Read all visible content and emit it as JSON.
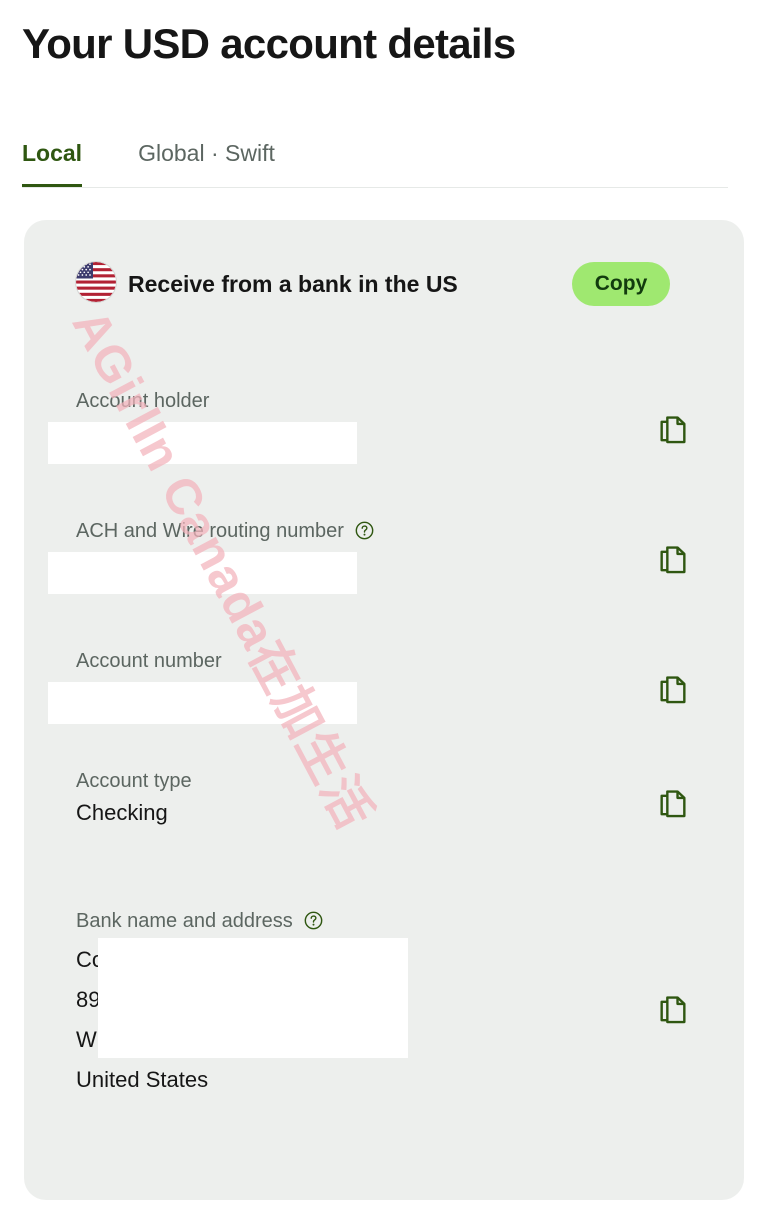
{
  "page": {
    "title": "Your USD account details"
  },
  "tabs": [
    {
      "label": "Local",
      "active": true
    },
    {
      "label": "Global · Swift",
      "active": false
    }
  ],
  "card": {
    "flag_icon": "us-flag-icon",
    "header_title": "Receive from a bank in the US",
    "copy_all_label": "Copy",
    "copy_icon": "copy-icon",
    "help_icon": "help-circle-icon",
    "fields": [
      {
        "label": "Account holder",
        "has_help": false,
        "value": "",
        "redacted": true
      },
      {
        "label": "ACH and Wire routing number",
        "has_help": true,
        "value": "",
        "redacted": true
      },
      {
        "label": "Account number",
        "has_help": false,
        "value": "",
        "redacted": true
      },
      {
        "label": "Account type",
        "has_help": false,
        "value": "Checking",
        "redacted": false
      },
      {
        "label": "Bank name and address",
        "has_help": true,
        "value": "Co                      s Bank\n89\nW\nUnited States",
        "redacted": true
      }
    ]
  },
  "watermark": {
    "text": "AGirlIn Canada在加生活",
    "color": "#f3b3bc"
  },
  "colors": {
    "accent_green": "#9fe870",
    "dark_green": "#2f5711",
    "card_background": "#edefed",
    "label_gray": "#5c6661",
    "text_black": "#161616"
  }
}
